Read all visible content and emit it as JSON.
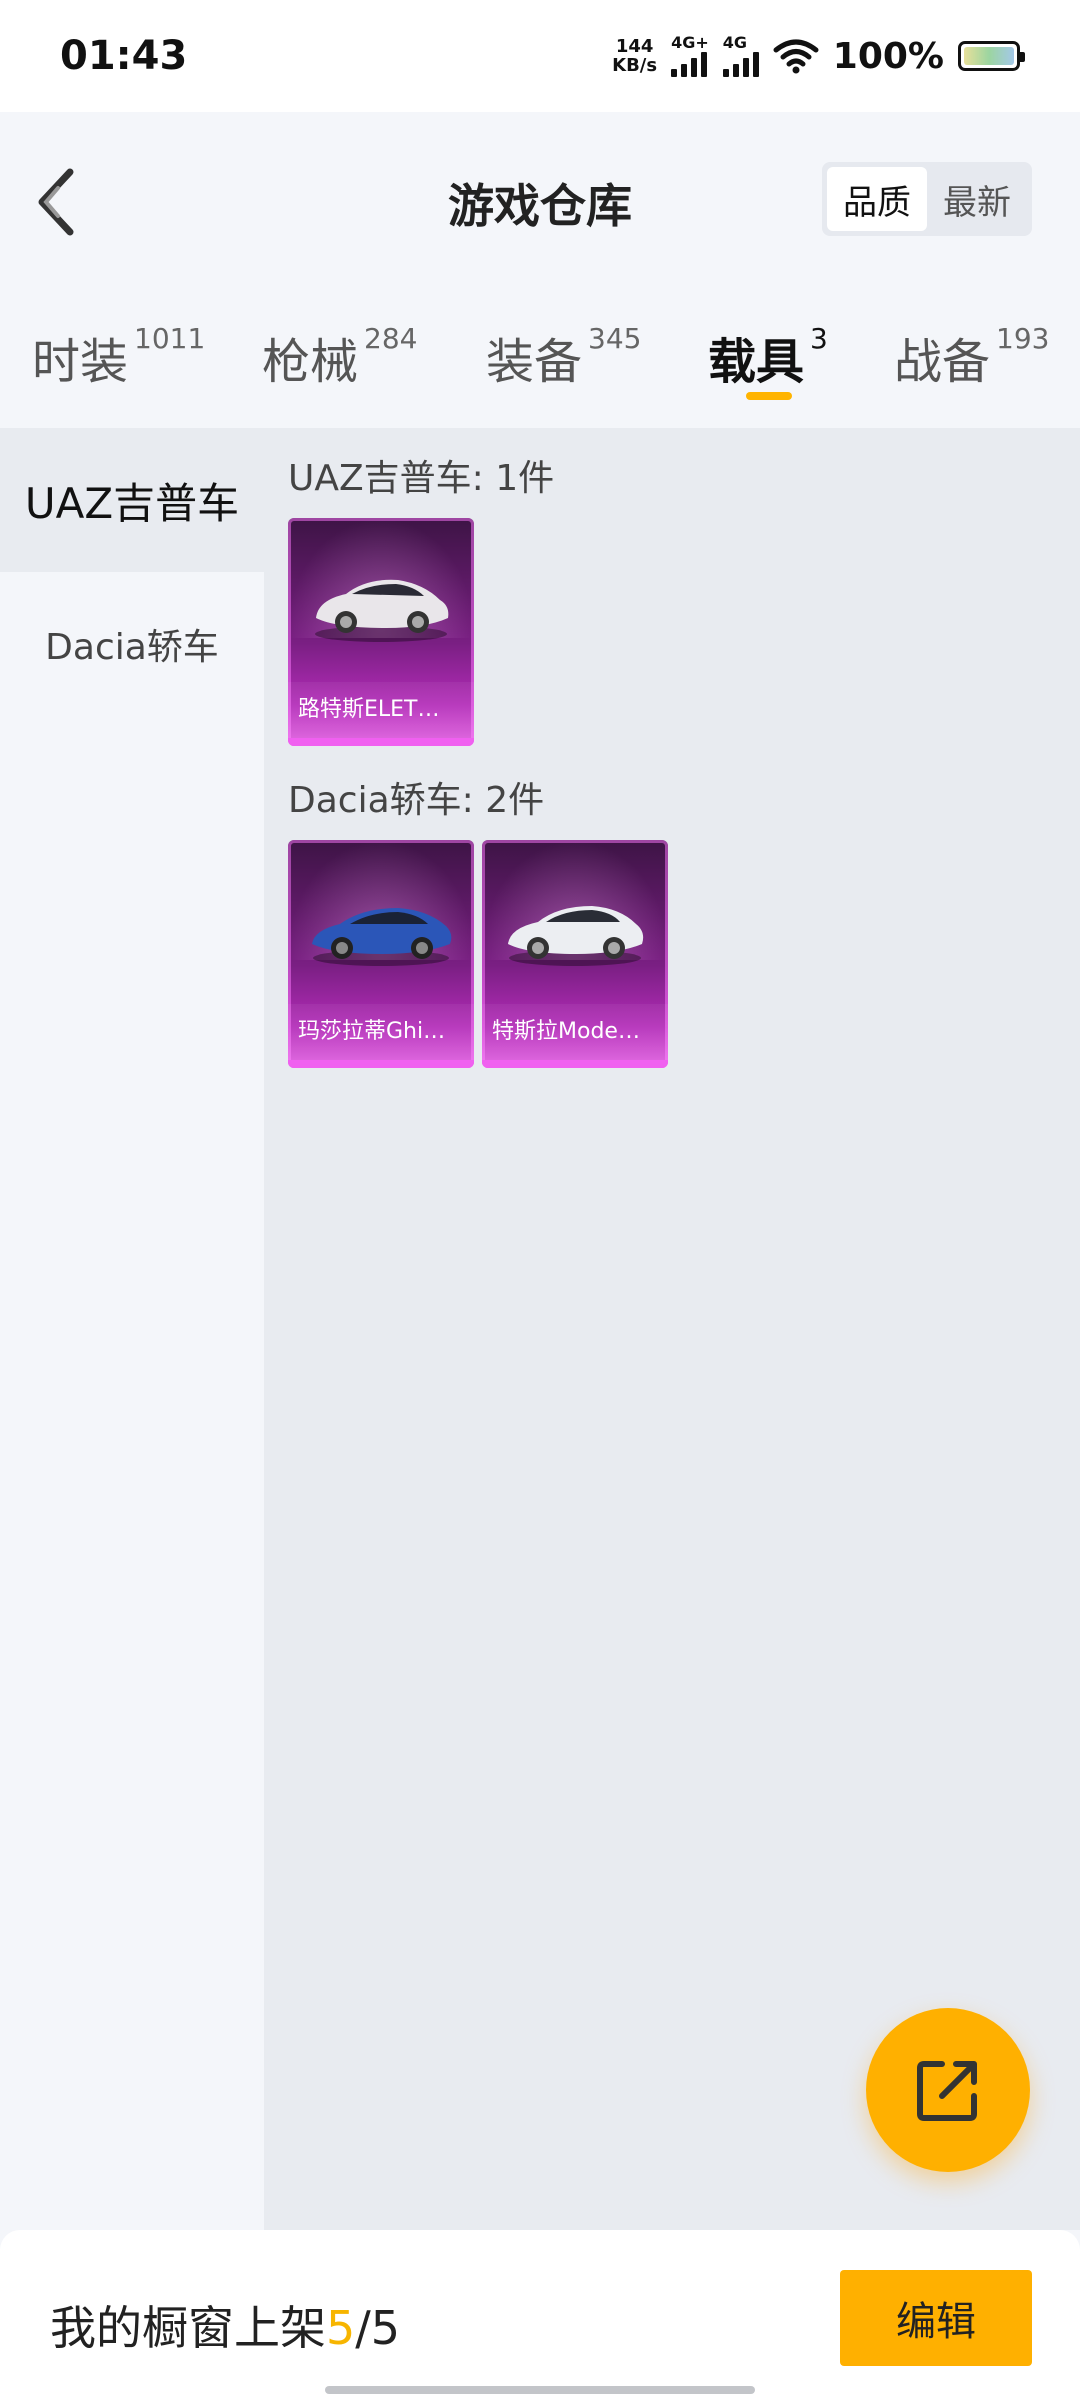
{
  "status": {
    "time": "01:43",
    "net_speed_value": "144",
    "net_speed_unit": "KB/s",
    "sim1": "4G+",
    "sim2": "4G",
    "battery": "100%"
  },
  "header": {
    "title": "游戏仓库",
    "sort_options": [
      "品质",
      "最新"
    ],
    "sort_selected": "品质"
  },
  "tabs": [
    {
      "label": "时装",
      "count": "1011"
    },
    {
      "label": "枪械",
      "count": "284"
    },
    {
      "label": "装备",
      "count": "345"
    },
    {
      "label": "载具",
      "count": "3"
    },
    {
      "label": "战备",
      "count": "193"
    }
  ],
  "active_tab": "载具",
  "sidebar": {
    "items": [
      {
        "label": "UAZ吉普车"
      },
      {
        "label": "Dacia轿车"
      }
    ],
    "selected": "UAZ吉普车"
  },
  "groups": [
    {
      "title": "UAZ吉普车: 1件",
      "items": [
        {
          "name": "路特斯ELET…",
          "color": "#e9e6ea"
        }
      ]
    },
    {
      "title": "Dacia轿车: 2件",
      "items": [
        {
          "name": "玛莎拉蒂Ghi…",
          "color": "#2b56b8"
        },
        {
          "name": "特斯拉Mode…",
          "color": "#eceef2"
        }
      ]
    }
  ],
  "colors": {
    "accent": "#ffb000",
    "card_purple": "#7a1f83"
  },
  "fab": {
    "icon": "share-icon"
  },
  "bottom": {
    "showcase_label": "我的橱窗上架",
    "showcase_used": "5",
    "showcase_sep": "/",
    "showcase_total": "5",
    "edit_label": "编辑"
  }
}
